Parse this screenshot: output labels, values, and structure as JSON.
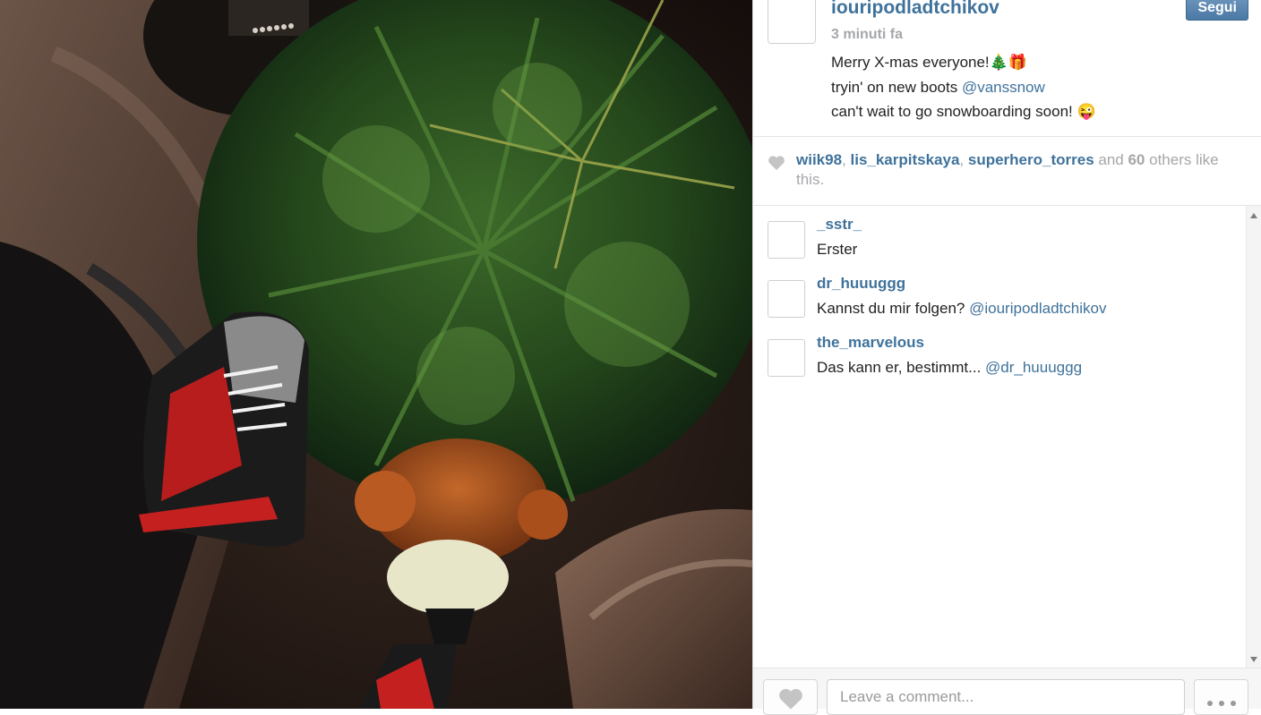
{
  "post": {
    "username": "iouripodladtchikov",
    "time_ago": "3 minuti fa",
    "follow_label": "Segui",
    "caption": {
      "line1": "Merry X-mas everyone!🎄🎁",
      "line2_text": "tryin' on new boots ",
      "line2_mention": "@vanssnow",
      "line3": "can't wait to go snowboarding soon! 😜"
    }
  },
  "likes": {
    "user1": "wiik98",
    "sep1": ", ",
    "user2": "lis_karpitskaya",
    "sep2": ", ",
    "user3": "superhero_torres",
    "and": " and ",
    "count": "60",
    "others": " others like this."
  },
  "comments": [
    {
      "user": "_sstr_",
      "text": "Erster",
      "mention": ""
    },
    {
      "user": "dr_huuuggg",
      "text": "Kannst du mir folgen? ",
      "mention": "@iouripodladtchikov"
    },
    {
      "user": "the_marvelous",
      "text": "Das kann er, bestimmt... ",
      "mention": "@dr_huuuggg"
    }
  ],
  "footer": {
    "comment_placeholder": "Leave a comment..."
  },
  "colors": {
    "link": "#3f729b",
    "follow_button": "#5b87af",
    "muted": "#a5a7aa"
  },
  "icons": [
    "heart-icon",
    "more-dots-icon",
    "scroll-up-icon",
    "scroll-down-icon"
  ]
}
